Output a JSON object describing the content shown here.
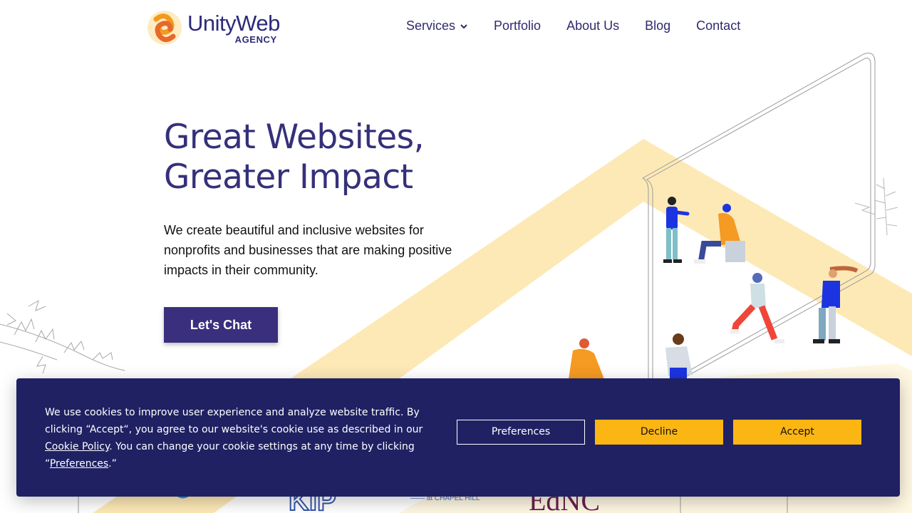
{
  "brand": {
    "name": "UnityWeb",
    "sub": "AGENCY"
  },
  "nav": {
    "items": [
      {
        "label": "Services"
      },
      {
        "label": "Portfolio"
      },
      {
        "label": "About Us"
      },
      {
        "label": "Blog"
      },
      {
        "label": "Contact"
      }
    ]
  },
  "hero": {
    "title_line1": "Great Websites,",
    "title_line2": "Greater Impact",
    "body": "We create beautiful and inclusive websites for nonprofits and businesses that are making positive impacts in their community.",
    "cta": "Let's Chat"
  },
  "cookie": {
    "text_1": "We use cookies to improve user experience and analyze website traffic. By clicking “Accept“, you agree to our website's cookie use as described in our ",
    "cookie_policy_link": "Cookie Policy",
    "text_2": ". You can change your cookie settings at any time by clicking “",
    "preferences_link": "Preferences",
    "text_3": ".”",
    "preferences_button": "Preferences",
    "decline_button": "Decline",
    "accept_button": "Accept"
  },
  "colors": {
    "primary": "#35307a",
    "banner_bg": "#1f2163",
    "accent_yellow": "#fbb614",
    "band": "#fde9b6"
  },
  "icons": [
    "chevron-down-icon",
    "logo-mark-icon"
  ]
}
